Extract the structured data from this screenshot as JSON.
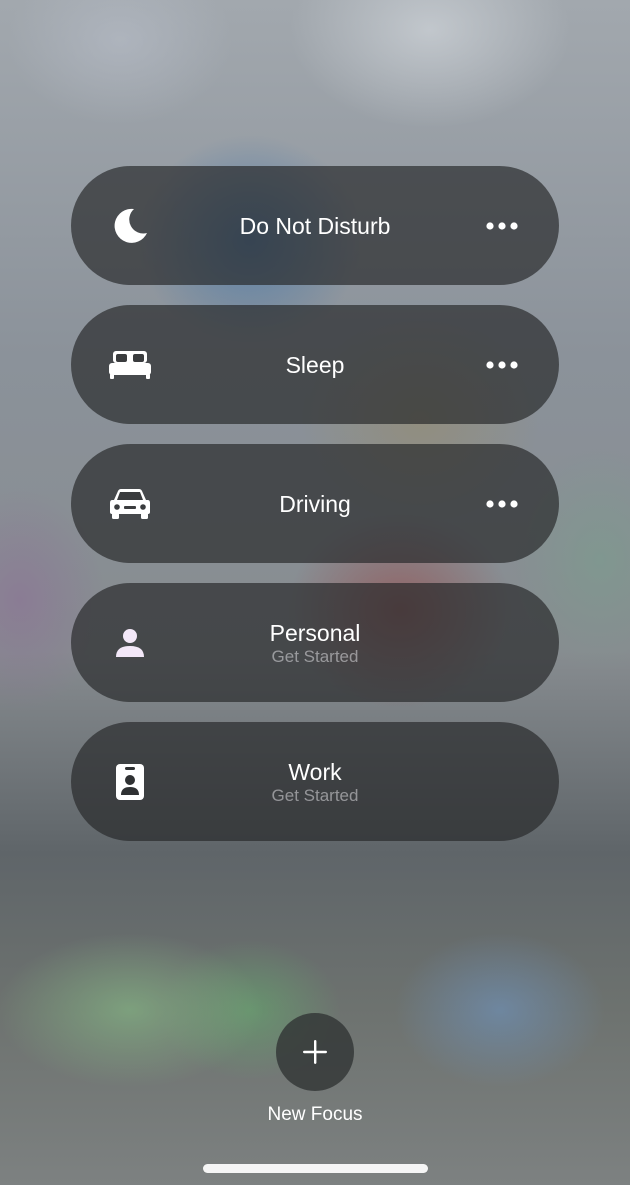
{
  "focus_modes": [
    {
      "id": "do-not-disturb",
      "title": "Do Not Disturb",
      "subtitle": "",
      "icon": "moon-icon",
      "has_more": true
    },
    {
      "id": "sleep",
      "title": "Sleep",
      "subtitle": "",
      "icon": "bed-icon",
      "has_more": true
    },
    {
      "id": "driving",
      "title": "Driving",
      "subtitle": "",
      "icon": "car-icon",
      "has_more": true
    },
    {
      "id": "personal",
      "title": "Personal",
      "subtitle": "Get Started",
      "icon": "person-icon",
      "has_more": false
    },
    {
      "id": "work",
      "title": "Work",
      "subtitle": "Get Started",
      "icon": "id-badge-icon",
      "has_more": false
    }
  ],
  "new_focus": {
    "label": "New Focus",
    "icon": "plus-icon"
  },
  "colors": {
    "row_background": "#26282a",
    "subtitle_text": "#ebebf0",
    "primary_text": "#ffffff"
  }
}
